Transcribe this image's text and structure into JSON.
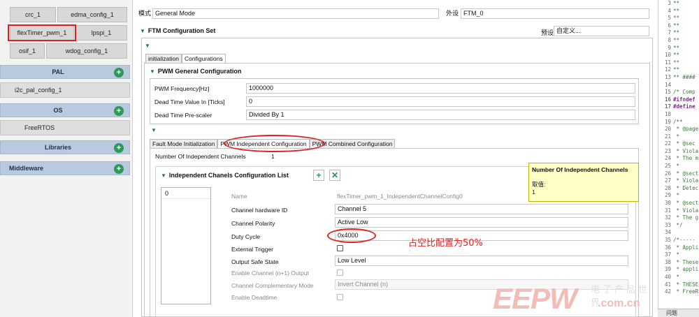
{
  "left_panel": {
    "tiles": [
      "crc_1",
      "edma_config_1",
      "flexTimer_pwm_1",
      "lpspi_1",
      "osif_1",
      "wdog_config_1"
    ],
    "sections": [
      {
        "label": "PAL",
        "icon": "plus-circle-icon"
      },
      {
        "label": "OS",
        "icon": "plus-circle-icon"
      },
      {
        "label": "Libraries",
        "icon": "plus-circle-icon"
      },
      {
        "label": "Middleware",
        "icon": "plus-circle-icon"
      }
    ],
    "pal_item": "i2c_pal_config_1",
    "os_item": "FreeRTOS"
  },
  "header": {
    "mode_label": "模式",
    "mode_value": "General Mode",
    "periph_label": "外设",
    "periph_value": "FTM_0"
  },
  "ftm": {
    "title": "FTM Configuration Set",
    "preset_label": "预设",
    "preset_value": "自定义..."
  },
  "outer_tabs": [
    "initialization",
    "Configurations"
  ],
  "pwm_general": {
    "title": "PWM General Configuration",
    "fields": [
      {
        "label": "PWM Frequency[Hz]",
        "value": "1000000"
      },
      {
        "label": "Dead Time Value In [Ticks]",
        "value": "0"
      },
      {
        "label": "Dead Time Pre-scaler",
        "value": "Divided By 1"
      }
    ]
  },
  "inner_tabs": [
    "Fault Mode Initialization",
    "PWM Independent Configuration",
    "PWM Combined Configuration"
  ],
  "independent": {
    "count_label": "Number Of Independent Channels",
    "count_value": "1",
    "list_title": "Independent Chanels Configuration List",
    "list_items": [
      "0"
    ],
    "fields": [
      {
        "label": "Name",
        "value": "flexTimer_pwm_1_IndependentChannelConfig0",
        "disabled": true
      },
      {
        "label": "Channel hardware ID",
        "value": "Channel 5"
      },
      {
        "label": "Channel Polarity",
        "value": "Active Low"
      },
      {
        "label": "Duty Cycle",
        "value": "0x4000"
      },
      {
        "label": "External Trigger",
        "value": ""
      },
      {
        "label": "Output Safe State",
        "value": "Low Level"
      },
      {
        "label": "Enable Channel (n+1) Output",
        "value": "",
        "disabled": true
      },
      {
        "label": "Channel Complementary Mode",
        "value": "Invert Channel (n)",
        "disabled": true
      },
      {
        "label": "Enable Deadtime",
        "value": "",
        "disabled": true
      }
    ]
  },
  "tooltip": {
    "title": "Number Of Independent Channels",
    "value_label": "取值:",
    "value": "1"
  },
  "annotation": "占空比配置为50%",
  "code_lines": [
    {
      "n": "3",
      "t": "**"
    },
    {
      "n": "4",
      "t": "**"
    },
    {
      "n": "5",
      "t": "**"
    },
    {
      "n": "6",
      "t": "**"
    },
    {
      "n": "7",
      "t": "**"
    },
    {
      "n": "8",
      "t": "**"
    },
    {
      "n": "9",
      "t": "**"
    },
    {
      "n": "10",
      "t": "**"
    },
    {
      "n": "11",
      "t": "**"
    },
    {
      "n": "12",
      "t": "**"
    },
    {
      "n": "13",
      "t": "** ####"
    },
    {
      "n": "14",
      "t": ""
    },
    {
      "n": "15",
      "t": "/* Comp"
    },
    {
      "n": "16",
      "t": "#ifndef",
      "pp": true
    },
    {
      "n": "17",
      "t": "#define",
      "pp": true
    },
    {
      "n": "18",
      "t": ""
    },
    {
      "n": "19",
      "t": "/**"
    },
    {
      "n": "20",
      "t": " * @page"
    },
    {
      "n": "21",
      "t": " *"
    },
    {
      "n": "22",
      "t": "  * @sec"
    },
    {
      "n": "23",
      "t": " * Viola"
    },
    {
      "n": "24",
      "t": " * The m"
    },
    {
      "n": "25",
      "t": " *"
    },
    {
      "n": "26",
      "t": " * @sect"
    },
    {
      "n": "27",
      "t": " * Viola"
    },
    {
      "n": "28",
      "t": " * Detec"
    },
    {
      "n": "29",
      "t": " *"
    },
    {
      "n": "30",
      "t": " * @sect"
    },
    {
      "n": "31",
      "t": " * Viola"
    },
    {
      "n": "32",
      "t": " * The g"
    },
    {
      "n": "33",
      "t": " */"
    },
    {
      "n": "34",
      "t": ""
    },
    {
      "n": "35",
      "t": "/*-----"
    },
    {
      "n": "36",
      "t": " * Appli"
    },
    {
      "n": "37",
      "t": " *"
    },
    {
      "n": "38",
      "t": " * These"
    },
    {
      "n": "39",
      "t": " * appli"
    },
    {
      "n": "40",
      "t": " *"
    },
    {
      "n": "41",
      "t": " * THESE"
    },
    {
      "n": "42",
      "t": " * FreeR"
    }
  ],
  "problems_tab": "问题",
  "watermark": {
    "brand": "EEPW",
    "domain": ".com.cn",
    "tagline": "电子产品世界"
  },
  "colors": {
    "section_bg": "#b9c9de",
    "add_green": "#2d9a5b",
    "highlight_red": "#e02020",
    "tooltip_bg": "#ffffc8"
  }
}
